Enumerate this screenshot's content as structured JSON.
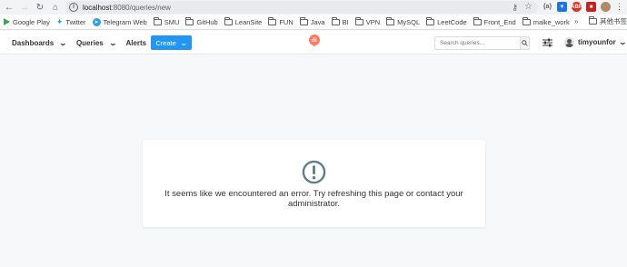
{
  "browser": {
    "url_host": "localhost",
    "url_path": ":8080/queries/new",
    "bookmarks": [
      {
        "label": "Google Play",
        "icon": "google-play-icon"
      },
      {
        "label": "Twitter",
        "icon": "twitter-icon"
      },
      {
        "label": "Telegram Web",
        "icon": "telegram-icon"
      },
      {
        "label": "SMU",
        "icon": "folder-icon"
      },
      {
        "label": "GitHub",
        "icon": "folder-icon"
      },
      {
        "label": "LeanSite",
        "icon": "folder-icon"
      },
      {
        "label": "FUN",
        "icon": "folder-icon"
      },
      {
        "label": "Java",
        "icon": "folder-icon"
      },
      {
        "label": "BI",
        "icon": "folder-icon"
      },
      {
        "label": "VPN",
        "icon": "folder-icon"
      },
      {
        "label": "MySQL",
        "icon": "folder-icon"
      },
      {
        "label": "LeetCode",
        "icon": "folder-icon"
      },
      {
        "label": "Front_End",
        "icon": "folder-icon"
      },
      {
        "label": "malke_work",
        "icon": "folder-icon"
      }
    ],
    "bookmarks_more": "»",
    "other_bookmarks": "其他书签"
  },
  "app": {
    "nav": {
      "dashboards": "Dashboards",
      "queries": "Queries",
      "alerts": "Alerts",
      "create": "Create"
    },
    "search_placeholder": "Search queries...",
    "username": "timyounfor",
    "brand_color": "#2196f3",
    "logo_color": "#ff7964"
  },
  "error": {
    "message": "It seems like we encountered an error. Try refreshing this page or contact your administrator.",
    "icon": "exclamation-circle-icon",
    "icon_color": "#607d8b"
  }
}
